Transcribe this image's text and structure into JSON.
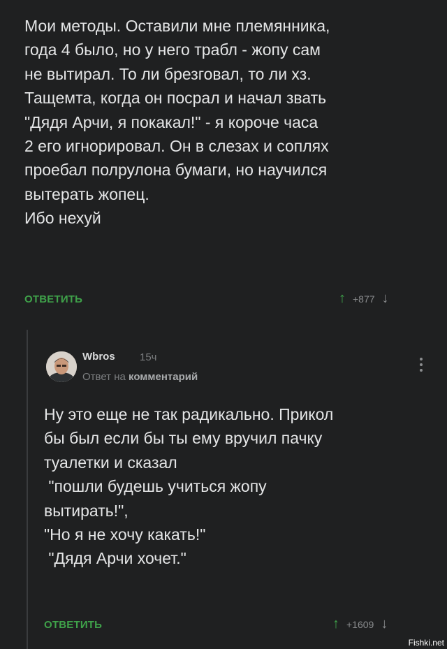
{
  "comment": {
    "lines": [
      "Мои методы. Оставили мне племянника,",
      "года 4 было, но у него трабл - жопу сам",
      "не вытирал. То ли брезговал, то ли хз.",
      "Тащемта, когда он посрал и начал звать",
      "\"Дядя Арчи, я покакал!\" - я короче часа",
      "2 его игнорировал. Он в слезах и соплях",
      "проебал полрулона бумаги, но научился",
      "вытерать жопец.",
      "Ибо нехуй"
    ],
    "reply_label": "ОТВЕТИТЬ",
    "rating": "+877"
  },
  "reply": {
    "author": "Wbros",
    "time": "15ч",
    "reply_to_prefix": "Ответ на",
    "reply_to_link": "комментарий",
    "lines": [
      "Ну это еще не так радикально. Прикол",
      "бы был если бы ты ему вручил пачку",
      "туалетки и сказал",
      " \"пошли будешь учиться жопу",
      "вытирать!\",",
      "\"Но я не хочу какать!\"",
      " \"Дядя Арчи хочет.\""
    ],
    "reply_label": "ОТВЕТИТЬ",
    "rating": "+1609"
  },
  "icons": {
    "up": "arrow-up-icon",
    "down": "arrow-down-icon",
    "menu": "more-vertical-icon"
  },
  "colors": {
    "background": "#1f2021",
    "accent": "#3fa24a",
    "muted": "#7c7e80"
  },
  "watermark": "Fishki.net"
}
